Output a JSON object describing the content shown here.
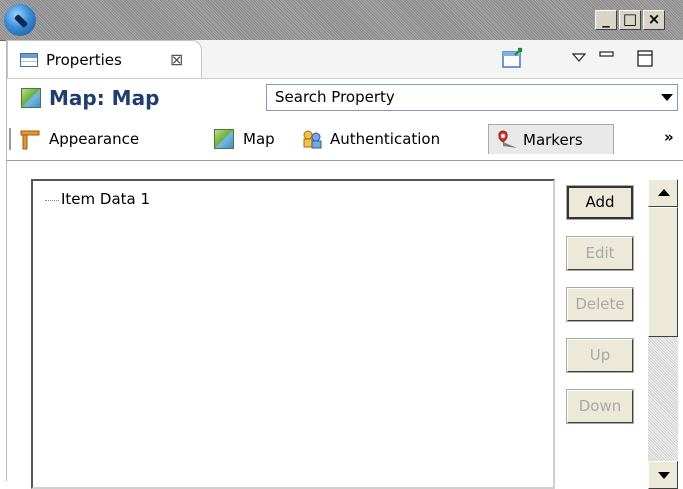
{
  "window": {
    "minimize_label": "_",
    "maximize_label": "□",
    "close_label": "×"
  },
  "view_tab": {
    "label": "Properties",
    "close_glyph": "⊠"
  },
  "view_toolbar": {
    "pin_icon": "pin-editor-icon",
    "menu_icon": "view-menu-icon",
    "minimize_icon": "minimize-icon",
    "maximize_icon": "maximize-icon"
  },
  "header": {
    "title": "Map: Map",
    "search_value": "Search Property"
  },
  "property_tabs": [
    {
      "label": "Appearance",
      "icon": "appearance-icon"
    },
    {
      "label": "Map",
      "icon": "map-icon"
    },
    {
      "label": "Authentication",
      "icon": "authentication-icon"
    },
    {
      "label": "Markers",
      "icon": "marker-icon",
      "active": true
    }
  ],
  "overflow_chevron": "»",
  "list": {
    "items": [
      "Item Data 1"
    ]
  },
  "buttons": {
    "add": "Add",
    "edit": "Edit",
    "delete": "Delete",
    "up": "Up",
    "down": "Down"
  },
  "colors": {
    "title_text": "#1f3e6e",
    "disabled_text": "#a8a8a8",
    "button_face": "#ece9d8"
  }
}
